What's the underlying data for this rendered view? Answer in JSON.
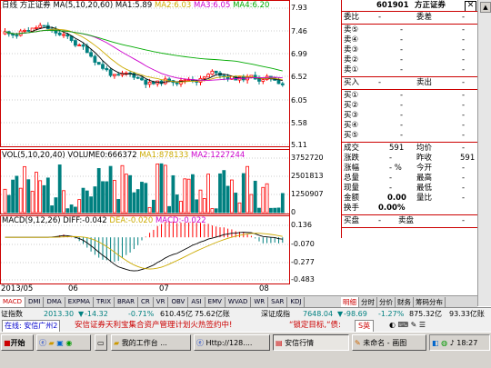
{
  "header": {
    "period": "日线",
    "stock_name": "方正证券",
    "ma_label": "MA(5,10,20,60)",
    "ma1": "MA1:5.89",
    "ma2": "MA2:6.03",
    "ma3": "MA3:6.05",
    "ma4": "MA4:6.20"
  },
  "price_axis": [
    "7.93",
    "7.46",
    "6.99",
    "6.52",
    "6.05",
    "5.58",
    "5.11"
  ],
  "volume_header": {
    "label": "VOL(5,10,20,40)",
    "volume": "VOLUME0:666372",
    "ma1": "MA1:878133",
    "ma2": "MA2:1227244"
  },
  "volume_axis": [
    "3752720",
    "2501813",
    "1250907",
    "0"
  ],
  "macd_header": {
    "label": "MACD(9,12,26)",
    "diff": "DIFF:-0.042",
    "dea": "DEA:-0.020",
    "macd": "MACD:-0.022"
  },
  "macd_axis": [
    "0.136",
    "-0.070",
    "-0.277",
    "-0.483"
  ],
  "date_axis": [
    "2013/05",
    "06",
    "07",
    "08"
  ],
  "indicator_tabs": [
    "MACD",
    "DMI",
    "DMA",
    "EXPMA",
    "TRIX",
    "BRAR",
    "CR",
    "VR",
    "OBV",
    "ASI",
    "EMV",
    "WVAD",
    "WR",
    "SAR",
    "KDJ"
  ],
  "quote": {
    "code": "601901",
    "name": "方正证券",
    "close_icon": "close-icon",
    "weibi": {
      "label": "委比",
      "value": "-",
      "label2": "委差",
      "value2": "-"
    },
    "sell": [
      {
        "label": "卖⑤",
        "price": "-",
        "vol": "-"
      },
      {
        "label": "卖④",
        "price": "-",
        "vol": "-"
      },
      {
        "label": "卖③",
        "price": "-",
        "vol": "-"
      },
      {
        "label": "卖②",
        "price": "-",
        "vol": "-"
      },
      {
        "label": "卖①",
        "price": "-",
        "vol": "-"
      }
    ],
    "buy_header": {
      "label": "买入",
      "value": "-",
      "label2": "卖出",
      "value2": "-"
    },
    "buy": [
      {
        "label": "买①",
        "price": "-",
        "vol": "-"
      },
      {
        "label": "买②",
        "price": "-",
        "vol": "-"
      },
      {
        "label": "买③",
        "price": "-",
        "vol": "-"
      },
      {
        "label": "买④",
        "price": "-",
        "vol": "-"
      },
      {
        "label": "买⑤",
        "price": "-",
        "vol": "-"
      }
    ],
    "stats": [
      {
        "l1": "成交",
        "v1": "591",
        "l2": "均价",
        "v2": "-"
      },
      {
        "l1": "涨跌",
        "v1": "-",
        "l2": "昨收",
        "v2": "591"
      },
      {
        "l1": "涨幅",
        "v1": "- %",
        "l2": "今开",
        "v2": "-"
      },
      {
        "l1": "总量",
        "v1": "-",
        "l2": "最高",
        "v2": "-"
      },
      {
        "l1": "现量",
        "v1": "-",
        "l2": "最低",
        "v2": "-"
      },
      {
        "l1": "金额",
        "v1": "0.00",
        "l2": "量比",
        "v2": "-"
      },
      {
        "l1": "换手",
        "v1": "0.00%",
        "l2": "",
        "v2": ""
      }
    ],
    "pan": {
      "label": "买盘",
      "value": "-",
      "label2": "卖盘",
      "value2": "-"
    }
  },
  "right_tabs": [
    "明细",
    "分时",
    "分价",
    "财务",
    "筹码分布"
  ],
  "status": {
    "idx1_name": "证指数",
    "idx1_value": "2013.30",
    "idx1_change": "-14.32",
    "idx1_pct": "-0.71%",
    "idx1_amount": "610.45亿",
    "idx1_extra": "75.62亿账",
    "idx2_name": "深证成指",
    "idx2_value": "7648.04",
    "idx2_change": "-98.69",
    "idx2_pct": "-1.27%",
    "idx2_amount": "875.32亿",
    "idx2_extra": "93.33亿账"
  },
  "news": {
    "left": "在线: 安信广州2",
    "text": "安信证券天利宝集合资产管理计划火热签约中!",
    "text2": "“锁定目标,“债:",
    "ime": "S英"
  },
  "taskbar": {
    "start": "开始",
    "items": [
      "我的工作台 ...",
      "Http://128....",
      "安信行情",
      "未命名 - 画图"
    ],
    "clock": "18:27"
  },
  "colors": {
    "up": "#ff0000",
    "down": "#008080",
    "ma1": "#000000",
    "ma2": "#ccaa00",
    "ma3": "#cc00cc",
    "ma4": "#00aa00",
    "frame": "#cc0000"
  }
}
